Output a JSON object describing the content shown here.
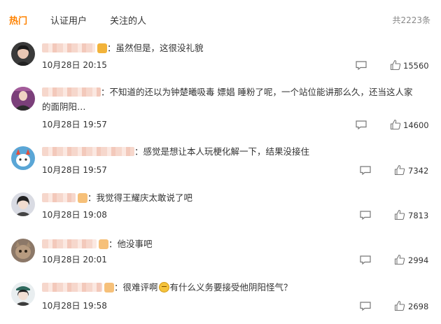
{
  "tabs": [
    {
      "label": "热门",
      "active": true
    },
    {
      "label": "认证用户",
      "active": false
    },
    {
      "label": "关注的人",
      "active": false
    }
  ],
  "total": "共2223条",
  "colors": {
    "accent": "#ff8200",
    "text": "#333333",
    "muted": "#888888"
  },
  "icons": {
    "reply": "comment-icon",
    "like": "thumbs-up-icon"
  },
  "comments": [
    {
      "text": "：虽然但是，这很没礼貌",
      "time": "10月28日 20:15",
      "likes": "15560"
    },
    {
      "text": "：不知道的还以为钟楚曦吸毒 嫖娼 睡粉了呢，一个站位能讲那么久，还当这人家的面阴阳…",
      "time": "10月28日 19:57",
      "likes": "14600"
    },
    {
      "text": "：感觉是想让本人玩梗化解一下，结果没接住",
      "time": "10月28日 19:57",
      "likes": "7342"
    },
    {
      "text": "：我觉得王耀庆太敢说了吧",
      "time": "10月28日 19:08",
      "likes": "7813"
    },
    {
      "text": "：他没事吧",
      "time": "10月28日 20:01",
      "likes": "2994"
    },
    {
      "text_before": "：很难评啊",
      "text_after": "有什么义务要接受他阴阳怪气？",
      "time": "10月28日 19:58",
      "likes": "2698"
    }
  ]
}
